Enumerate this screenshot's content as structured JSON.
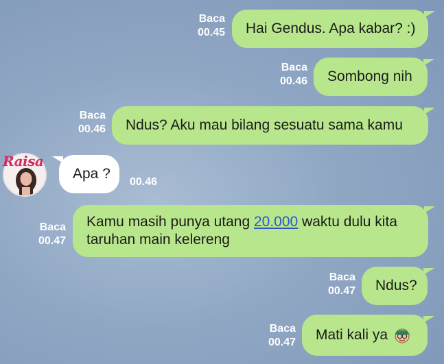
{
  "messages": [
    {
      "id": "m1",
      "direction": "out",
      "text": "Hai Gendus. Apa kabar? :)",
      "read_label": "Baca",
      "time": "00.45"
    },
    {
      "id": "m2",
      "direction": "out",
      "text": "Sombong nih",
      "read_label": "Baca",
      "time": "00.46"
    },
    {
      "id": "m3",
      "direction": "out",
      "text": "Ndus? Aku mau bilang sesuatu sama kamu",
      "read_label": "Baca",
      "time": "00.46"
    },
    {
      "id": "m4",
      "direction": "in",
      "sender_logo_text": "Raisa",
      "text": "Apa ?",
      "time": "00.46"
    },
    {
      "id": "m5",
      "direction": "out",
      "text_before_link": "Kamu masih punya utang ",
      "link_text": "20.000",
      "text_after_link": " waktu dulu kita",
      "text_line2": "taruhan main kelereng",
      "read_label": "Baca",
      "time": "00.47"
    },
    {
      "id": "m6",
      "direction": "out",
      "text": "Ndus?",
      "read_label": "Baca",
      "time": "00.47"
    },
    {
      "id": "m7",
      "direction": "out",
      "text": "Mati kali ya",
      "emoji_icon": "cap-glasses-face-icon",
      "read_label": "Baca",
      "time": "00.47"
    }
  ],
  "colors": {
    "outgoing_bubble": "#b8e68c",
    "incoming_bubble": "#ffffff",
    "meta_text": "#ffffff",
    "link": "#2f56c8",
    "background": "#90a7c4",
    "logo": "#d12d63"
  }
}
